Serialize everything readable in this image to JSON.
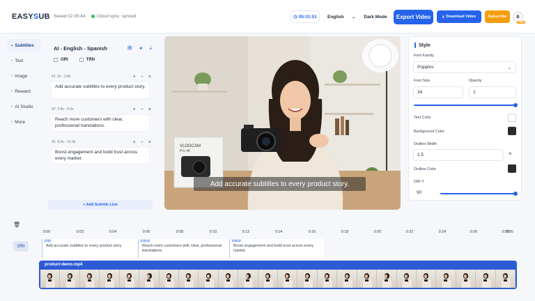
{
  "header": {
    "logo_part1": "EASY",
    "logo_part2": "S",
    "logo_part3": "UB",
    "saved": "Saved 02:35:44",
    "cloud_sync": "Cloud sync: synced",
    "timer": "05:01:51",
    "language": "English",
    "dark_mode": "Dark Mode",
    "export_video": "Export Video",
    "download_video": "Download Video",
    "subscribe": "Subscribe",
    "avatar_initial": "B",
    "avatar_badge": "PRO"
  },
  "sidebar": {
    "items": [
      {
        "label": "Subtitles",
        "active": true
      },
      {
        "label": "Text",
        "active": false
      },
      {
        "label": "Image",
        "active": false
      },
      {
        "label": "Reward",
        "active": false
      },
      {
        "label": "AI Studio",
        "active": false
      },
      {
        "label": "More",
        "active": false
      }
    ]
  },
  "subtitles": {
    "title": "AI - English - Spanish",
    "toggle_ori": "ORI",
    "toggle_trn": "TRN",
    "lines": [
      {
        "num": "#1",
        "time": "0s - 2.8s",
        "text": "Add accurate subtitles to every product story."
      },
      {
        "num": "#2",
        "time": "2.8s - 6.5s",
        "text": "Reach more customers with clear, professional translations."
      },
      {
        "num": "#3",
        "time": "6.5s - 10.4s",
        "text": "Boost engagement and build trust across every market."
      }
    ],
    "add_line": "+ Add Subtitle Line"
  },
  "video": {
    "caption": "Add accurate subtitles to every product story.",
    "box_brand": "VLOGCAM",
    "box_model": "Pro 4K"
  },
  "style": {
    "heading": "Style",
    "font_family_label": "Font Family",
    "font_family": "Poppins",
    "font_size_label": "Font Size",
    "font_size": "34",
    "opacity_label": "Opacity",
    "opacity": "1",
    "text_color_label": "Text Color",
    "text_color": "#ffffff",
    "bg_color_label": "Background Color",
    "bg_color": "#2b2b2b",
    "outline_width_label": "Outline Width",
    "outline_width": "1.5",
    "outline_color_label": "Outline Color",
    "outline_color": "#2b2b2b",
    "ori_y_label": "ORI Y",
    "ori_y": "90"
  },
  "timeline": {
    "ticks": [
      "0:00",
      "0:02",
      "0:04",
      "0:06",
      "0:08",
      "0:10",
      "0:12",
      "0:14",
      "0:16",
      "0:18",
      "0:20",
      "0:22",
      "0:24",
      "0:26",
      "0:28",
      "0:30"
    ],
    "track_label": "ORI",
    "segments": [
      {
        "time": "0:00",
        "text": "Add accurate subtitles to every product story."
      },
      {
        "time": "0:02.8",
        "text": "Reach more customers with clear, professional translations."
      },
      {
        "time": "0:06.5",
        "text": "Boost engagement and build trust across every market."
      }
    ],
    "clip_name": "product-demo.mp4"
  },
  "colors": {
    "accent": "#2563eb",
    "subscribe": "#f59e0b"
  }
}
